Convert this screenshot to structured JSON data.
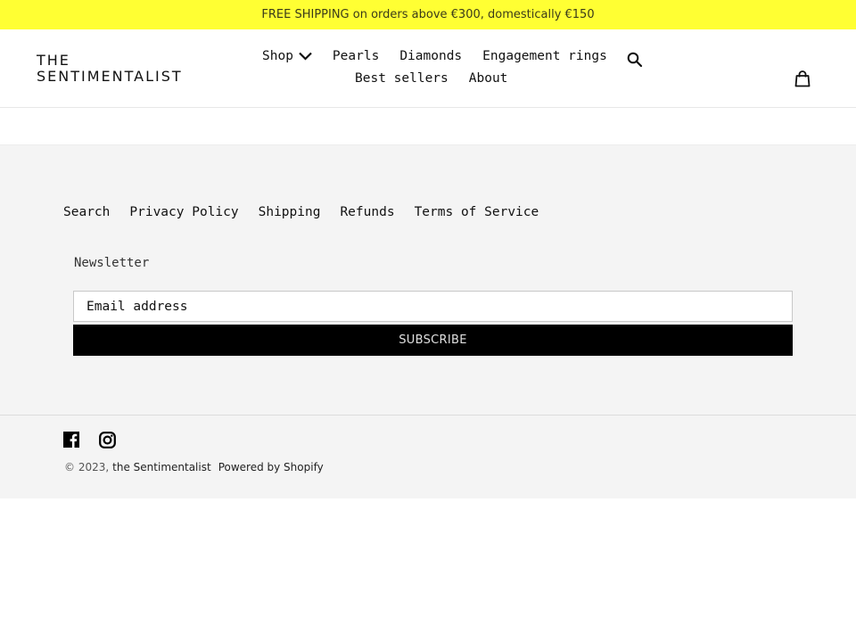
{
  "announcement": {
    "text": "FREE SHIPPING on orders above €300, domestically €150",
    "background": "#ffff33"
  },
  "header": {
    "logo": {
      "line1": "THE",
      "line2": "SENTIMENTALIST"
    },
    "nav": {
      "row1": [
        {
          "label": "Shop",
          "has_dropdown": true,
          "icon": "chevron-down-icon"
        },
        {
          "label": "Pearls"
        },
        {
          "label": "Diamonds"
        },
        {
          "label": "Engagement rings"
        }
      ],
      "row2": [
        {
          "label": "Best sellers"
        },
        {
          "label": "About"
        }
      ]
    },
    "search_icon": "search-icon",
    "cart_icon": "cart-bag-icon"
  },
  "footer": {
    "links": [
      "Search",
      "Privacy Policy",
      "Shipping",
      "Refunds",
      "Terms of Service"
    ],
    "newsletter": {
      "label": "Newsletter",
      "email_placeholder": "Email address",
      "email_value": "",
      "subscribe_label": "SUBSCRIBE"
    },
    "social": [
      {
        "name": "Facebook",
        "icon": "facebook-icon"
      },
      {
        "name": "Instagram",
        "icon": "instagram-icon"
      }
    ],
    "copyright": {
      "year": "© 2023,",
      "store_name": "the Sentimentalist",
      "powered_by": "Powered by Shopify"
    }
  }
}
